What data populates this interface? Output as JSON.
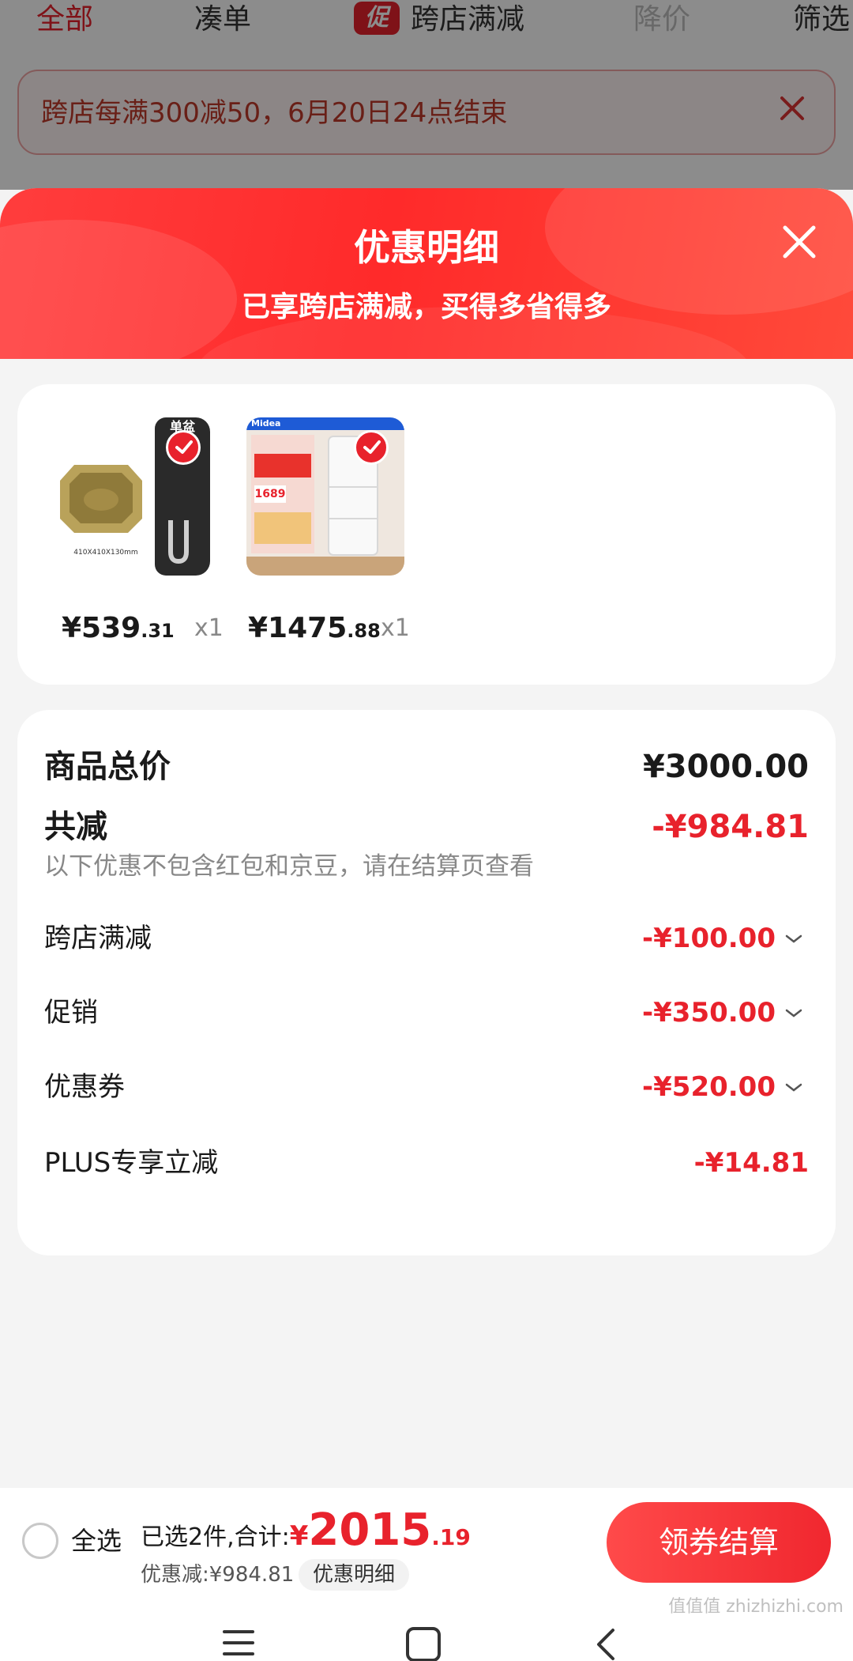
{
  "top_tabs": {
    "all": "全部",
    "bundle": "凑单",
    "promo_icon": "促",
    "cross_store": "跨店满减",
    "price_drop": "降价",
    "filter": "筛选"
  },
  "notice": {
    "text": "跨店每满300减50，6月20日24点结束",
    "close_icon": "close-icon"
  },
  "sheet": {
    "title": "优惠明细",
    "subtitle": "已享跨店满减，买得多省得多",
    "close_icon": "close-icon"
  },
  "products": [
    {
      "image_label": "410X410X130mm",
      "corner_text": "单盆",
      "price_int": "¥539",
      "price_dec": ".31",
      "qty": "x1"
    },
    {
      "image_label": "Midea",
      "badge_price": "1689",
      "price_int": "¥1475",
      "price_dec": ".88",
      "qty": "x1"
    }
  ],
  "breakdown": {
    "total_label": "商品总价",
    "total_value": "¥3000.00",
    "reduce_label": "共减",
    "reduce_value": "-¥984.81",
    "note": "以下优惠不包含红包和京豆，请在结算页查看",
    "items": [
      {
        "label": "跨店满减",
        "value": "-¥100.00",
        "expandable": true
      },
      {
        "label": "促销",
        "value": "-¥350.00",
        "expandable": true
      },
      {
        "label": "优惠券",
        "value": "-¥520.00",
        "expandable": true
      },
      {
        "label": "PLUS专享立减",
        "value": "-¥14.81",
        "expandable": false
      }
    ]
  },
  "bottom_bar": {
    "select_all": "全选",
    "selected_text": "已选2件,合计:",
    "total_yen": "¥",
    "total_int": "2015",
    "total_dec": ".19",
    "discount_text": "优惠减:¥984.81",
    "detail_chip": "优惠明细",
    "checkout": "领券结算"
  },
  "watermark": "值值值 zhizhizhi.com",
  "colors": {
    "accent": "#e8222c",
    "header_red": "#ff3333",
    "muted": "#888888"
  }
}
